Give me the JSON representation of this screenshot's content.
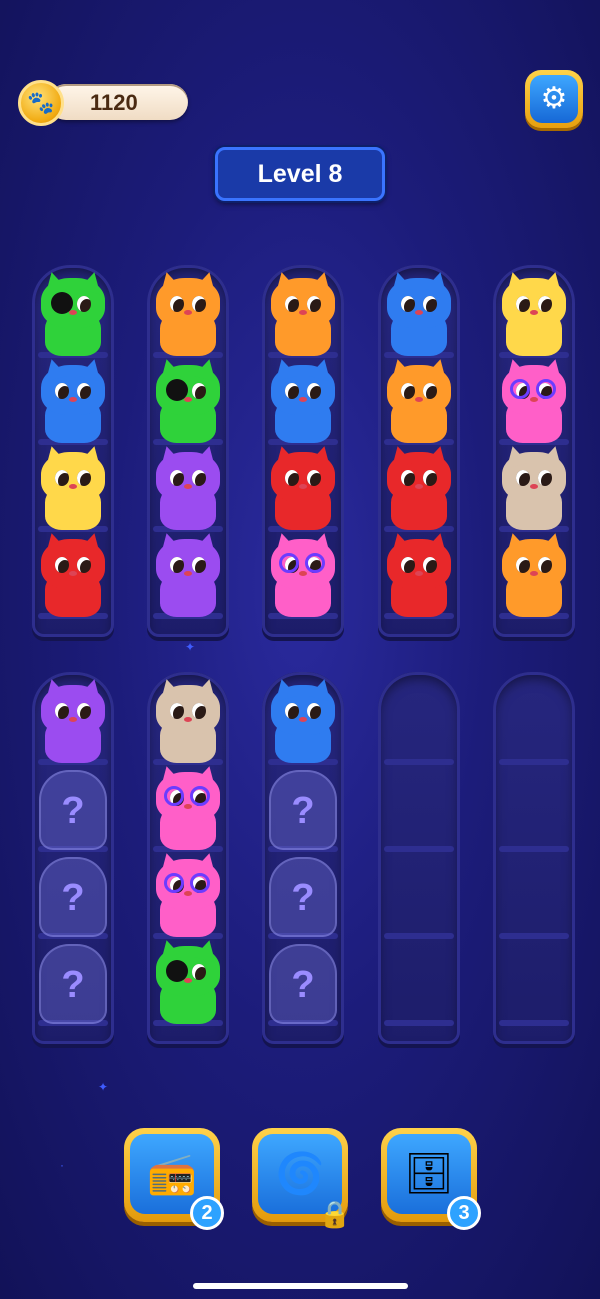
{
  "header": {
    "coins": "1120",
    "coin_icon": "paw-coin-icon",
    "settings_icon": "gear-icon",
    "level_label": "Level 8"
  },
  "colors": {
    "green": "#2fd23a",
    "orange": "#ff9a2a",
    "blue": "#2f7cf0",
    "yellow": "#ffd84a",
    "pink": "#ff5fc8",
    "red": "#e8282a",
    "purple": "#9b4cf0",
    "siamese": "#d9c3ad"
  },
  "tubes_top": [
    [
      "green-eyepatch",
      "blue",
      "yellow",
      "red"
    ],
    [
      "orange",
      "green-eyepatch",
      "purple",
      "purple"
    ],
    [
      "orange",
      "blue",
      "red",
      "pink-glasses"
    ],
    [
      "blue",
      "orange",
      "red",
      "red"
    ],
    [
      "yellow",
      "pink-glasses",
      "siamese",
      "orange"
    ]
  ],
  "tubes_bottom": [
    [
      "purple",
      "hidden",
      "hidden",
      "hidden"
    ],
    [
      "siamese",
      "pink-glasses",
      "pink-glasses",
      "green-eyepatch"
    ],
    [
      "blue",
      "hidden",
      "hidden",
      "hidden"
    ],
    [],
    []
  ],
  "mystery_symbol": "?",
  "boosters": [
    {
      "name": "walkie-talkie-booster",
      "icon": "walkie-talkie-icon",
      "count": "2",
      "locked": false
    },
    {
      "name": "fan-booster",
      "icon": "fan-icon",
      "count": "",
      "locked": true
    },
    {
      "name": "extra-shelf-booster",
      "icon": "shelf-plus-icon",
      "count": "3",
      "locked": false
    }
  ],
  "booster_glyphs": [
    "📻",
    "🌀",
    "🗄"
  ],
  "lock_glyph": "🔒"
}
